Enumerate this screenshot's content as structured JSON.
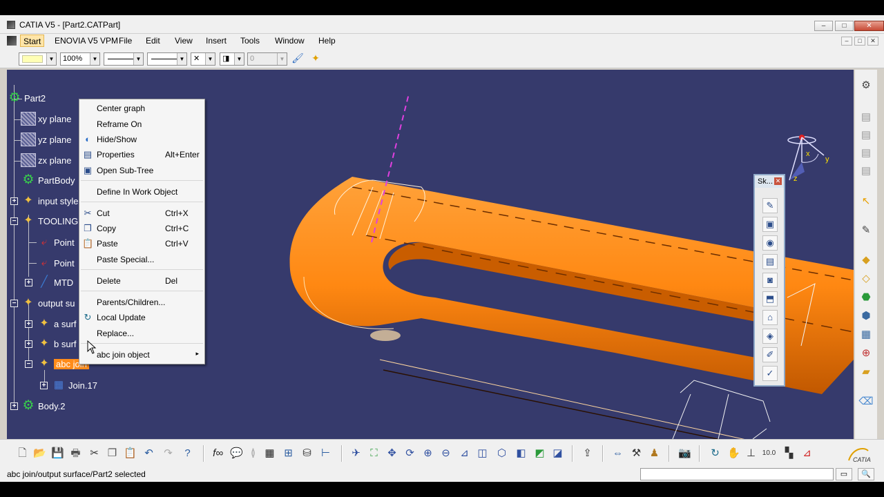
{
  "window": {
    "title": "CATIA V5 - [Part2.CATPart]",
    "min_glyph": "–",
    "max_glyph": "□",
    "close_glyph": "✕"
  },
  "menubar": {
    "items": [
      "Start",
      "ENOVIA V5 VPM",
      "File",
      "Edit",
      "View",
      "Insert",
      "Tools",
      "Window",
      "Help"
    ]
  },
  "properties_toolbar": {
    "color_value": "",
    "transparency_value": "100%",
    "thickness_value": "",
    "linetype_value": "",
    "point_symbol": "✕",
    "layer_value": "0"
  },
  "tree": {
    "nodes": [
      {
        "label": "Part2",
        "icon": "part-gear-icon"
      },
      {
        "label": "xy plane",
        "icon": "plane-icon"
      },
      {
        "label": "yz plane",
        "icon": "plane-icon"
      },
      {
        "label": "zx plane",
        "icon": "plane-icon"
      },
      {
        "label": "PartBody",
        "icon": "gear-icon"
      },
      {
        "label": "input style",
        "icon": "geometrical-set-icon"
      },
      {
        "label": "TOOLING",
        "icon": "geometrical-set-icon"
      },
      {
        "label": "Point",
        "icon": "point-icon"
      },
      {
        "label": "Point",
        "icon": "point-icon"
      },
      {
        "label": "MTD",
        "icon": "line-icon"
      },
      {
        "label": "output su",
        "icon": "geometrical-set-icon"
      },
      {
        "label": "a surf",
        "icon": "geometrical-set-icon"
      },
      {
        "label": "b surf",
        "icon": "geometrical-set-icon"
      },
      {
        "label": "abc join",
        "icon": "geometrical-set-icon"
      },
      {
        "label": "Join.17",
        "icon": "join-icon"
      },
      {
        "label": "Body.2",
        "icon": "gear-icon"
      }
    ]
  },
  "context_menu": {
    "items": [
      {
        "label": "Center graph",
        "shortcut": "",
        "icon": ""
      },
      {
        "label": "Reframe On",
        "shortcut": "",
        "icon": ""
      },
      {
        "label": "Hide/Show",
        "shortcut": "",
        "icon": "hide-show-icon"
      },
      {
        "label": "Properties",
        "shortcut": "Alt+Enter",
        "icon": "properties-icon"
      },
      {
        "label": "Open Sub-Tree",
        "shortcut": "",
        "icon": "open-subtree-icon"
      },
      {
        "label": "Define In Work Object",
        "shortcut": "",
        "icon": ""
      },
      {
        "label": "Cut",
        "shortcut": "Ctrl+X",
        "icon": "scissors-icon"
      },
      {
        "label": "Copy",
        "shortcut": "Ctrl+C",
        "icon": "copy-icon"
      },
      {
        "label": "Paste",
        "shortcut": "Ctrl+V",
        "icon": "paste-icon"
      },
      {
        "label": "Paste Special...",
        "shortcut": "",
        "icon": ""
      },
      {
        "label": "Delete",
        "shortcut": "Del",
        "icon": ""
      },
      {
        "label": "Parents/Children...",
        "shortcut": "",
        "icon": ""
      },
      {
        "label": "Local Update",
        "shortcut": "",
        "icon": "update-icon"
      },
      {
        "label": "Replace...",
        "shortcut": "",
        "icon": ""
      },
      {
        "label": "abc join object",
        "shortcut": "",
        "icon": "",
        "submenu": "▸"
      }
    ]
  },
  "sketch_toolbar": {
    "title": "Sk...",
    "close_glyph": "✕"
  },
  "compass": {
    "x_label": "x",
    "y_label": "y",
    "z_label": "z"
  },
  "statusbar": {
    "message": "abc join/output surface/Part2 selected",
    "input_value": ""
  },
  "colors": {
    "background": "#363a6c",
    "part_orange": "#ff8c1a",
    "selection": "#ff8c1a",
    "axis_magenta": "#e040e0"
  }
}
